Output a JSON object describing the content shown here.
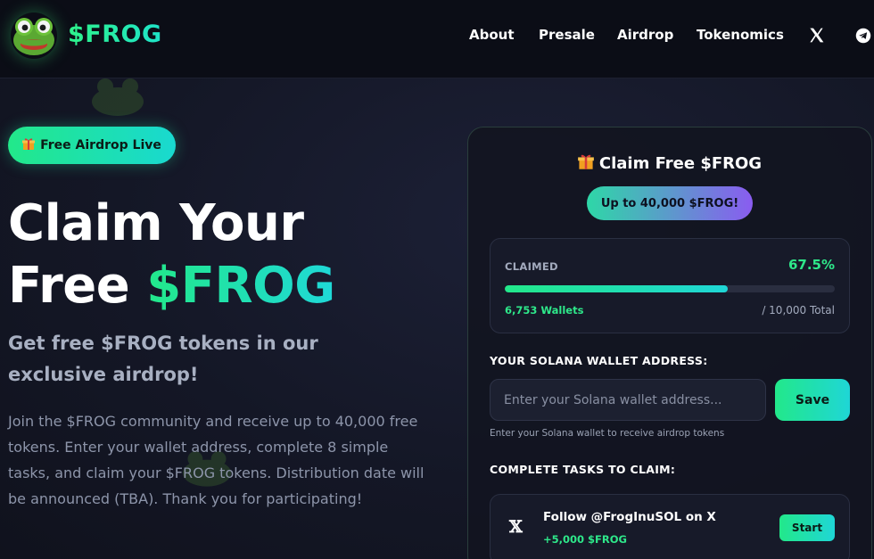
{
  "header": {
    "logo_icon": "frog-logo-icon",
    "brand": "$FROG",
    "nav": [
      "About",
      "Presale",
      "Airdrop",
      "Tokenomics"
    ],
    "social_icons": [
      "x-icon",
      "telegram-icon"
    ]
  },
  "hero": {
    "badge_icon": "gift-icon",
    "badge_label": "Free Airdrop Live",
    "title_line1": "Claim Your",
    "title_line2_plain": "Free ",
    "title_line2_accent": "$FROG",
    "subtitle": "Get free $FROG tokens in our exclusive airdrop!",
    "body": "Join the $FROG community and receive up to 40,000 free tokens. Enter your wallet address, complete 8 simple tasks, and claim your $FROG tokens. Distribution date will be announced (TBA). Thank you for participating!"
  },
  "claim_card": {
    "title_icon": "gift-icon",
    "title": "Claim Free $FROG",
    "max_badge": "Up to 40,000 $FROG!",
    "progress": {
      "label": "CLAIMED",
      "percent_text": "67.5%",
      "fraction": 0.675,
      "wallets": "6,753 Wallets",
      "total": "/ 10,000 Total"
    },
    "wallet": {
      "label": "YOUR SOLANA WALLET ADDRESS:",
      "value": "",
      "placeholder": "Enter your Solana wallet address...",
      "save_label": "Save",
      "help": "Enter your Solana wallet to receive airdrop tokens"
    },
    "tasks_label": "COMPLETE TASKS TO CLAIM:",
    "tasks": [
      {
        "icon": "x-icon",
        "glyph": "𝕏",
        "title": "Follow @FrogInuSOL on X",
        "reward": "+5,000 $FROG",
        "button": "Start"
      }
    ]
  },
  "colors": {
    "accent_green": "#22e88a",
    "accent_teal": "#1fd6d6",
    "accent_purple": "#8a5cf0",
    "background": "#141726"
  }
}
